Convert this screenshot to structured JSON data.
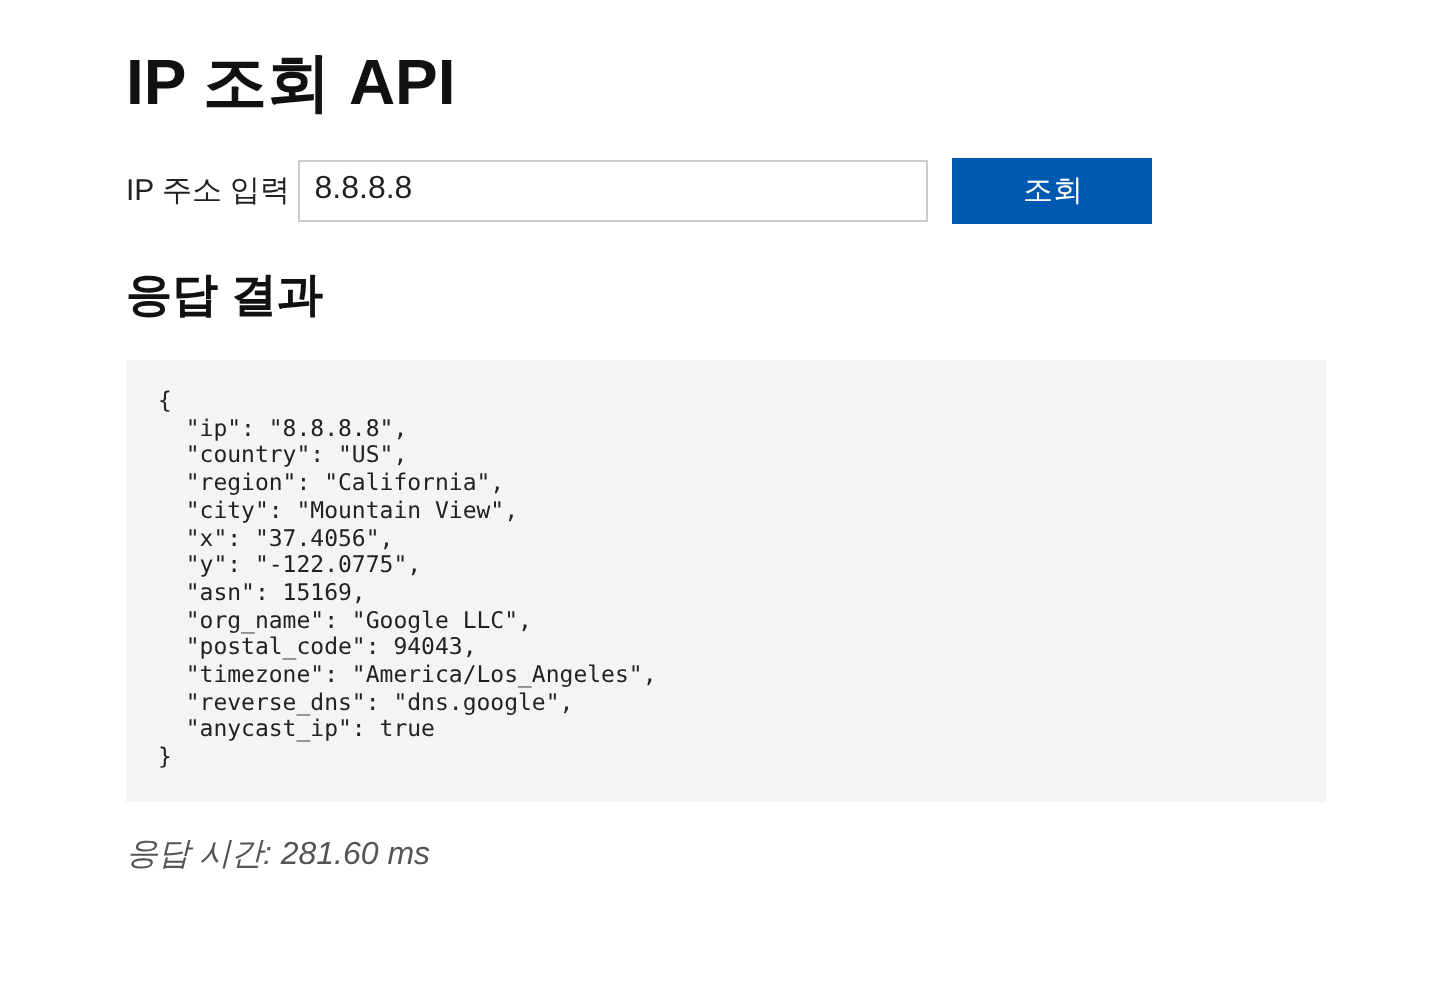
{
  "title": "IP 조회 API",
  "lookup": {
    "label": "IP 주소 입력",
    "value": "8.8.8.8",
    "button": "조회"
  },
  "result": {
    "heading": "응답 결과",
    "body": "{\n  \"ip\": \"8.8.8.8\",\n  \"country\": \"US\",\n  \"region\": \"California\",\n  \"city\": \"Mountain View\",\n  \"x\": \"37.4056\",\n  \"y\": \"-122.0775\",\n  \"asn\": 15169,\n  \"org_name\": \"Google LLC\",\n  \"postal_code\": 94043,\n  \"timezone\": \"America/Los_Angeles\",\n  \"reverse_dns\": \"dns.google\",\n  \"anycast_ip\": true\n}",
    "response_time": "응답 시간: 281.60 ms"
  }
}
